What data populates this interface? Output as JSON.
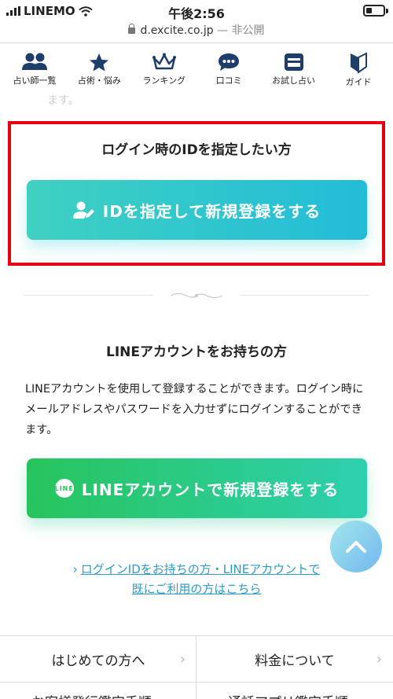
{
  "status_bar": {
    "carrier": "LINEMO",
    "time": "午後2:56"
  },
  "url_bar": {
    "domain": "d.excite.co.jp",
    "separator": "—",
    "visibility": "非公開"
  },
  "nav": {
    "items": [
      {
        "label": "占い師一覧",
        "icon": "users-icon"
      },
      {
        "label": "占術・悩み",
        "icon": "star-icon"
      },
      {
        "label": "ランキング",
        "icon": "crown-icon"
      },
      {
        "label": "口コミ",
        "icon": "chat-icon"
      },
      {
        "label": "お試し占い",
        "icon": "mail-icon"
      },
      {
        "label": "ガイド",
        "icon": "beginner-icon"
      }
    ],
    "ghost_text": "ます。"
  },
  "id_section": {
    "title": "ログイン時のIDを指定したい方",
    "button_label": "IDを指定して新規登録をする"
  },
  "line_section": {
    "title": "LINEアカウントをお持ちの方",
    "description": "LINEアカウントを使用して登録することができます。ログイン時にメールアドレスやパスワードを入力せずにログインすることができます。",
    "badge": "LINE",
    "button_label": "LINEアカウントで新規登録をする"
  },
  "existing_link": {
    "line1": "ログインIDをお持ちの方・LINEアカウントで",
    "line2": "既にご利用の方はこちら"
  },
  "footer": {
    "left": "はじめての方へ",
    "right": "料金について",
    "left_cut": "お客様発行鑑定手順",
    "right_cut": "通話アプリ鑑定手順"
  },
  "colors": {
    "accent_teal": "#22bcd8",
    "line_green": "#27c45d",
    "highlight_red": "#e60012",
    "link_blue": "#2a9cc8",
    "nav_icon": "#1e3d6b"
  }
}
